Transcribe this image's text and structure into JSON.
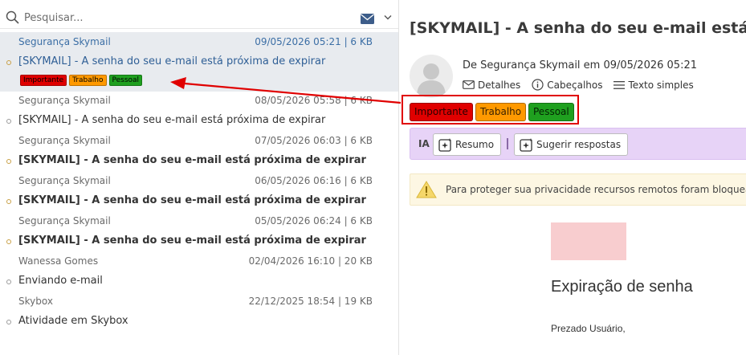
{
  "search": {
    "placeholder": "Pesquisar..."
  },
  "messages": [
    {
      "sender": "Segurança Skymail",
      "meta": "09/05/2026 05:21 | 6 KB",
      "subject": "[SKYMAIL] - A senha do seu e-mail está próxima de expirar",
      "bold": false,
      "selected": true,
      "tags": [
        {
          "label": "Importante",
          "color": "#e00000"
        },
        {
          "label": "Trabalho",
          "color": "#ff9900"
        },
        {
          "label": "Pessoal",
          "color": "#1fa01f"
        }
      ]
    },
    {
      "sender": "Segurança Skymail",
      "meta": "08/05/2026 05:58 | 6 KB",
      "subject": "[SKYMAIL] - A senha do seu e-mail está próxima de expirar",
      "bold": false
    },
    {
      "sender": "Segurança Skymail",
      "meta": "07/05/2026 06:03 | 6 KB",
      "subject": "[SKYMAIL] - A senha do seu e-mail está próxima de expirar",
      "bold": true
    },
    {
      "sender": "Segurança Skymail",
      "meta": "06/05/2026 06:16 | 6 KB",
      "subject": "[SKYMAIL] - A senha do seu e-mail está próxima de expirar",
      "bold": true
    },
    {
      "sender": "Segurança Skymail",
      "meta": "05/05/2026 06:24 | 6 KB",
      "subject": "[SKYMAIL] - A senha do seu e-mail está próxima de expirar",
      "bold": true
    },
    {
      "sender": "Wanessa Gomes",
      "meta": "02/04/2026 16:10 | 20 KB",
      "subject": "Enviando e-mail",
      "bold": false
    },
    {
      "sender": "Skybox",
      "meta": "22/12/2025 18:54 | 19 KB",
      "subject": "Atividade em Skybox",
      "bold": false
    }
  ],
  "reader": {
    "title": "[SKYMAIL] - A senha do seu e-mail está próxima de expirar",
    "from_line": "De Segurança Skymail em 09/05/2026 05:21",
    "actions": {
      "details": "Detalhes",
      "headers": "Cabeçalhos",
      "plain": "Texto simples"
    },
    "tags": [
      {
        "label": "Importante",
        "color": "#e00000"
      },
      {
        "label": "Trabalho",
        "color": "#ff9900"
      },
      {
        "label": "Pessoal",
        "color": "#1fa01f"
      }
    ],
    "ai": {
      "label": "IA",
      "summary": "Resumo",
      "suggest": "Sugerir respostas"
    },
    "privacy": "Para proteger sua privacidade recursos remotos foram bloqueados",
    "body_heading": "Expiração de senha",
    "body_greeting": "Prezado Usuário,"
  },
  "colors": {
    "selected_row": "#e8ebef",
    "accent_blue": "#2f5f96",
    "annotation_red": "#e00000",
    "ai_bar": "#e7d3f7",
    "privacy_bar": "#fdf7e3"
  }
}
